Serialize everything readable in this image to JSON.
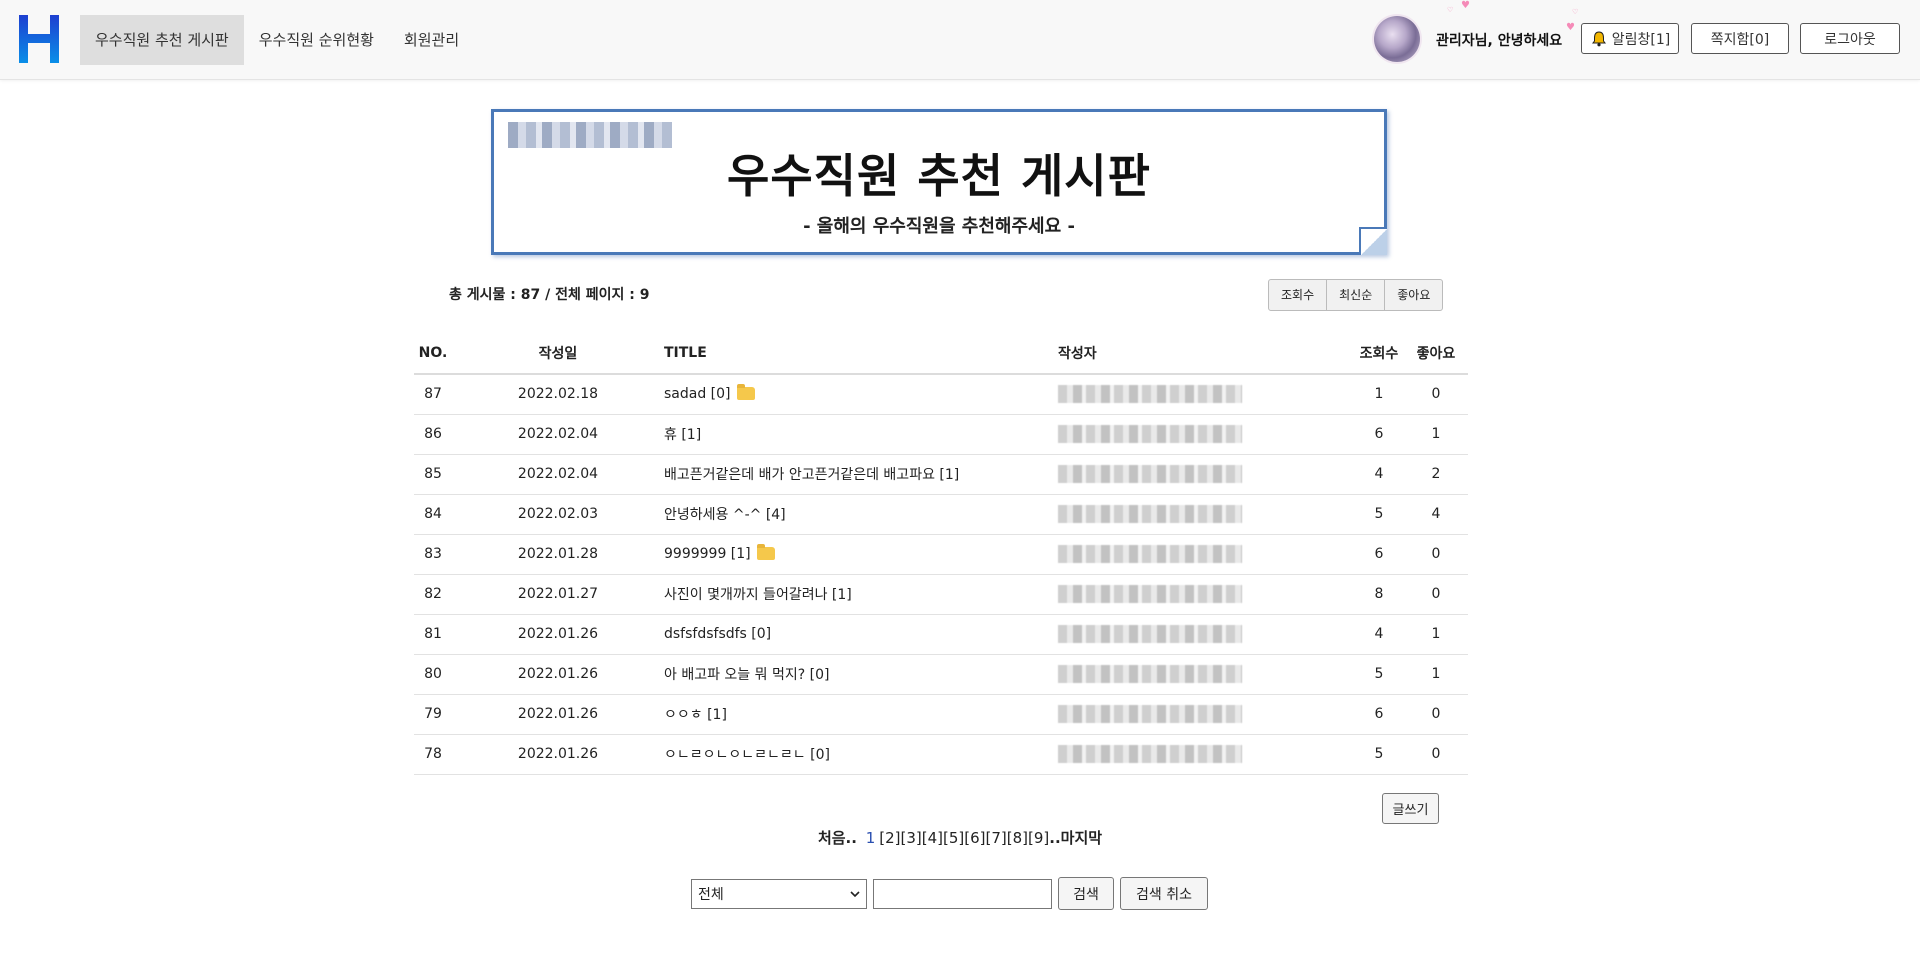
{
  "header": {
    "logo_text": "H",
    "nav": [
      {
        "label": "우수직원 추천 게시판",
        "active": true
      },
      {
        "label": "우수직원 순위현황",
        "active": false
      },
      {
        "label": "회원관리",
        "active": false
      }
    ],
    "greeting": "관리자님, 안녕하세요",
    "alarm_label": "알림창[1]",
    "message_label": "쪽지함[0]",
    "logout_label": "로그아웃"
  },
  "banner": {
    "title": "우수직원 추천 게시판",
    "subtitle": "- 올해의 우수직원을 추천해주세요 -"
  },
  "summary": {
    "text": "총 게시물 : 87 / 전체 페이지 : 9"
  },
  "sort_buttons": [
    "조회수",
    "최신순",
    "좋아요"
  ],
  "table": {
    "headers": {
      "no": "NO.",
      "date": "작성일",
      "title": "TITLE",
      "writer": "작성자",
      "views": "조회수",
      "likes": "좋아요"
    },
    "rows": [
      {
        "no": "87",
        "date": "2022.02.18",
        "title": "sadad [0]",
        "attachment": true,
        "views": "1",
        "likes": "0"
      },
      {
        "no": "86",
        "date": "2022.02.04",
        "title": "휴 [1]",
        "attachment": false,
        "views": "6",
        "likes": "1"
      },
      {
        "no": "85",
        "date": "2022.02.04",
        "title": "배고픈거같은데 배가 안고픈거같은데 배고파요 [1]",
        "attachment": false,
        "views": "4",
        "likes": "2"
      },
      {
        "no": "84",
        "date": "2022.02.03",
        "title": "안녕하세용 ^-^ [4]",
        "attachment": false,
        "views": "5",
        "likes": "4"
      },
      {
        "no": "83",
        "date": "2022.01.28",
        "title": "9999999 [1]",
        "attachment": true,
        "views": "6",
        "likes": "0"
      },
      {
        "no": "82",
        "date": "2022.01.27",
        "title": "사진이 몇개까지 들어갈려나 [1]",
        "attachment": false,
        "views": "8",
        "likes": "0"
      },
      {
        "no": "81",
        "date": "2022.01.26",
        "title": "dsfsfdsfsdfs [0]",
        "attachment": false,
        "views": "4",
        "likes": "1"
      },
      {
        "no": "80",
        "date": "2022.01.26",
        "title": "아 배고파 오늘 뭐 먹지? [0]",
        "attachment": false,
        "views": "5",
        "likes": "1"
      },
      {
        "no": "79",
        "date": "2022.01.26",
        "title": "ㅇㅇㅎ [1]",
        "attachment": false,
        "views": "6",
        "likes": "0"
      },
      {
        "no": "78",
        "date": "2022.01.26",
        "title": "ㅇㄴㄹㅇㄴㅇㄴㄹㄴㄹㄴ [0]",
        "attachment": false,
        "views": "5",
        "likes": "0"
      }
    ]
  },
  "write_label": "글쓰기",
  "pagination": {
    "first": "처음..",
    "current": "1",
    "pages": [
      "[2]",
      "[3]",
      "[4]",
      "[5]",
      "[6]",
      "[7]",
      "[8]",
      "[9]"
    ],
    "last": "..마지막"
  },
  "search": {
    "select_value": "전체",
    "input_value": "",
    "search_label": "검색",
    "cancel_label": "검색 취소"
  },
  "colors": {
    "logo_gradient_top": "#1e3fd0",
    "logo_gradient_bottom": "#0a8fe8",
    "banner_border": "#4a79b8",
    "current_page": "#2a4fb0",
    "bell": "#f2b600"
  }
}
